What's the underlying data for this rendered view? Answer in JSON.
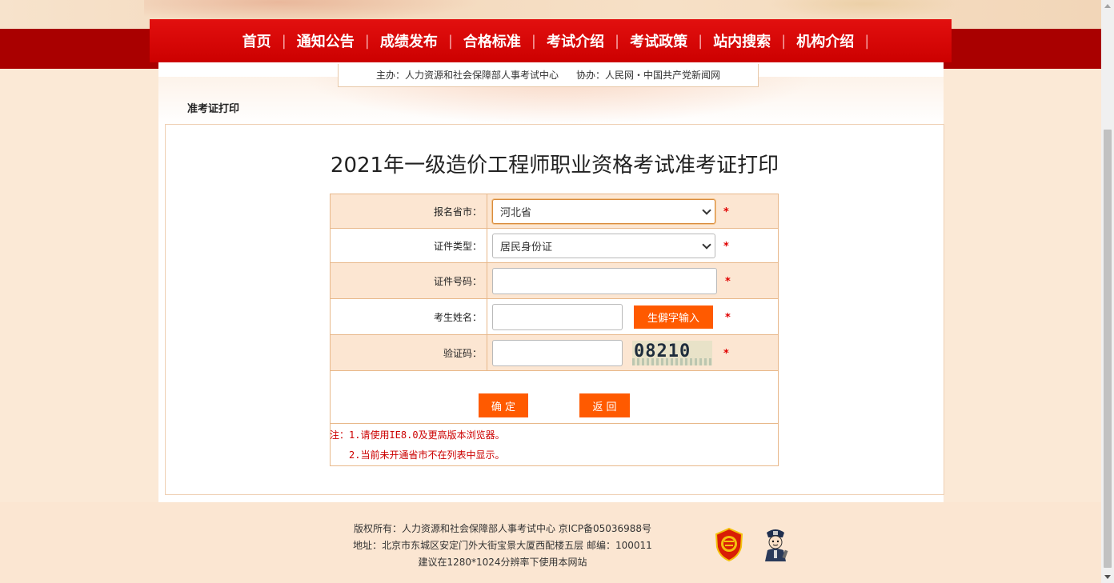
{
  "nav": {
    "items": [
      {
        "label": "首页"
      },
      {
        "label": "通知公告"
      },
      {
        "label": "成绩发布"
      },
      {
        "label": "合格标准"
      },
      {
        "label": "考试介绍"
      },
      {
        "label": "考试政策"
      },
      {
        "label": "站内搜索"
      },
      {
        "label": "机构介绍"
      }
    ],
    "separator": "|"
  },
  "sponsor": {
    "host": "主办：人力资源和社会保障部人事考试中心",
    "assist": "协办：人民网・中国共产党新闻网"
  },
  "breadcrumb": "准考证打印",
  "page_title": "2021年一级造价工程师职业资格考试准考证打印",
  "form": {
    "province_label": "报名省市：",
    "province_value": "河北省",
    "id_type_label": "证件类型：",
    "id_type_value": "居民身份证",
    "id_number_label": "证件号码：",
    "id_number_value": "",
    "name_label": "考生姓名：",
    "name_value": "",
    "rare_char_button": "生僻字输入",
    "captcha_label": "验证码：",
    "captcha_value": "",
    "captcha_text": "08210",
    "required_mark": "*",
    "confirm_button": "确 定",
    "back_button": "返 回"
  },
  "notes": {
    "line1": "注：1.请使用IE8.0及更高版本浏览器。",
    "line2": "2.当前未开通省市不在列表中显示。"
  },
  "footer": {
    "copyright": "版权所有：人力资源和社会保障部人事考试中心 京ICP备05036988号",
    "address": "地址：北京市东城区安定门外大街宝景大厦西配楼五层 邮编：100011",
    "advice": "建议在1280*1024分辨率下使用本网站"
  },
  "colors": {
    "nav_red": "#cc0000",
    "band_red": "#a90000",
    "accent_orange": "#ff5a00",
    "row_shade": "#fce6d2",
    "required_red": "#e00000"
  }
}
